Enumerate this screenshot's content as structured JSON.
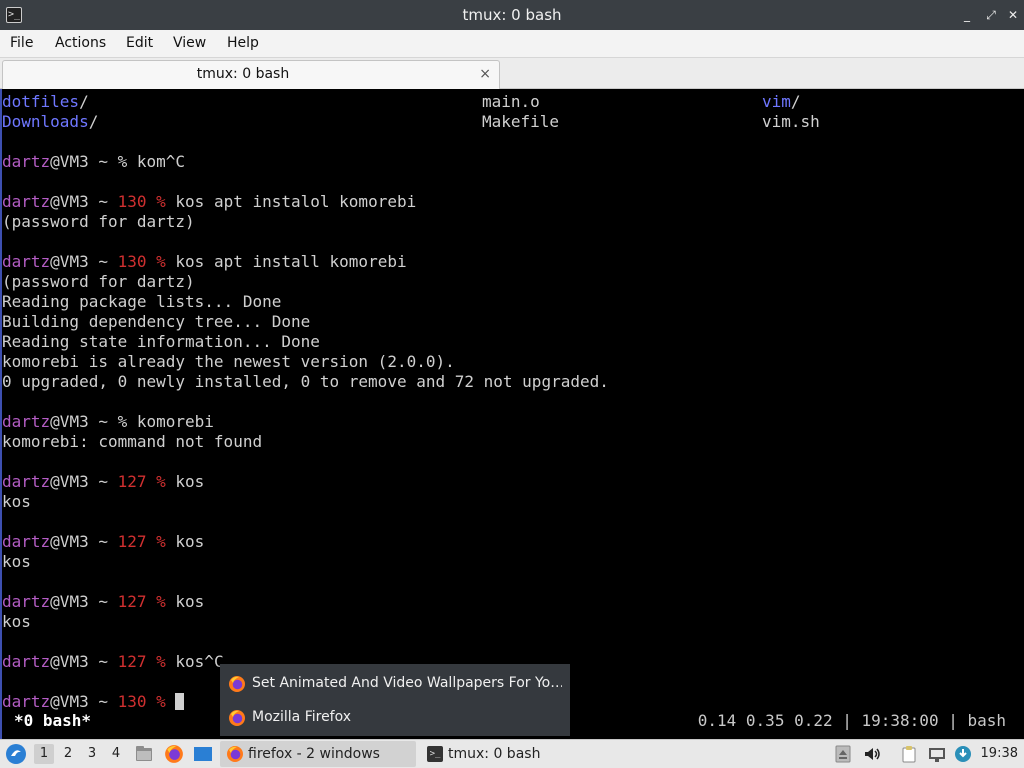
{
  "window": {
    "title": "tmux: 0 bash",
    "controls": [
      "_",
      "⤢",
      "✕"
    ]
  },
  "menubar": {
    "items": [
      "File",
      "Actions",
      "Edit",
      "View",
      "Help"
    ]
  },
  "tab": {
    "label": "tmux: 0 bash",
    "close": "×"
  },
  "terminal": {
    "listing": {
      "col1": [
        "dotfiles/",
        "Downloads/"
      ],
      "col2": [
        "main.o",
        "Makefile"
      ],
      "col3": [
        "vim/",
        "vim.sh"
      ]
    },
    "lines": [
      {
        "user": "dartz",
        "host": "@VM3 ~ ",
        "code": "",
        "prompt": "% ",
        "cmd": "kom^C"
      },
      {
        "user": "dartz",
        "host": "@VM3 ~ ",
        "code": "130 ",
        "prompt": "% ",
        "cmd": "kos apt instalol komorebi"
      },
      {
        "out": "(password for dartz)"
      },
      {
        "user": "dartz",
        "host": "@VM3 ~ ",
        "code": "130 ",
        "prompt": "% ",
        "cmd": "kos apt install komorebi"
      },
      {
        "out": "(password for dartz)"
      },
      {
        "out": "Reading package lists... Done"
      },
      {
        "out": "Building dependency tree... Done"
      },
      {
        "out": "Reading state information... Done"
      },
      {
        "out": "komorebi is already the newest version (2.0.0)."
      },
      {
        "out": "0 upgraded, 0 newly installed, 0 to remove and 72 not upgraded."
      },
      {
        "user": "dartz",
        "host": "@VM3 ~ ",
        "code": "",
        "prompt": "% ",
        "cmd": "komorebi"
      },
      {
        "out": "komorebi: command not found"
      },
      {
        "user": "dartz",
        "host": "@VM3 ~ ",
        "code": "127 ",
        "prompt": "% ",
        "cmd": "kos"
      },
      {
        "out": "kos"
      },
      {
        "user": "dartz",
        "host": "@VM3 ~ ",
        "code": "127 ",
        "prompt": "% ",
        "cmd": "kos"
      },
      {
        "out": "kos"
      },
      {
        "user": "dartz",
        "host": "@VM3 ~ ",
        "code": "127 ",
        "prompt": "% ",
        "cmd": "kos"
      },
      {
        "out": "kos"
      },
      {
        "user": "dartz",
        "host": "@VM3 ~ ",
        "code": "127 ",
        "prompt": "% ",
        "cmd": "kos^C"
      },
      {
        "user": "dartz",
        "host": "@VM3 ~ ",
        "code": "130 ",
        "prompt": "% ",
        "cmd": ""
      }
    ],
    "status_left": "*0 bash*",
    "status_right": "0.14 0.35 0.22 | 19:38:00 | bash"
  },
  "popup": {
    "items": [
      "Set Animated And Video Wallpapers For Yo…",
      "Mozilla Firefox"
    ]
  },
  "taskbar": {
    "workspaces": [
      "1",
      "2",
      "3",
      "4"
    ],
    "tasks": [
      "firefox - 2 windows",
      "tmux: 0 bash"
    ],
    "clock": "19:38"
  },
  "colors": {
    "directory": "#6f77ff",
    "username": "#b45dc4",
    "exit_code": "#d03030",
    "terminal_bg": "#000000",
    "titlebar_bg": "#3a3f44"
  }
}
